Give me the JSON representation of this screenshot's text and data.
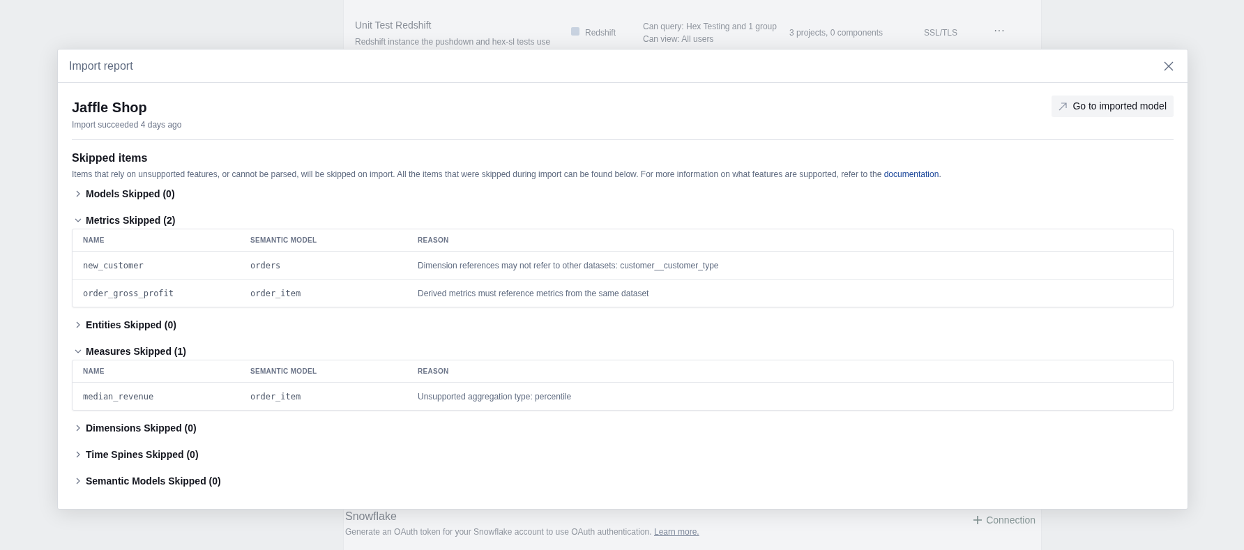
{
  "background": {
    "connection": {
      "name": "Unit Test Redshift",
      "description": "Redshift instance the pushdown and hex-sl tests use",
      "type_label": "Redshift",
      "permissions": [
        "Can query: Hex Testing and 1 group",
        "Can view: All users"
      ],
      "usage": "3 projects, 0 components",
      "security": "SSL/TLS",
      "more": "···"
    },
    "snowflake": {
      "title": "Snowflake",
      "description": "Generate an OAuth token for your Snowflake account to use OAuth authentication.",
      "link": "Learn more.",
      "button": "Connection"
    }
  },
  "modal": {
    "title": "Import report",
    "model": {
      "name": "Jaffle Shop",
      "status": "Import succeeded 4 days ago",
      "action_button": "Go to imported model"
    },
    "skipped": {
      "heading": "Skipped items",
      "description": "Items that rely on unsupported features, or cannot be parsed, will be skipped on import. All the items that were skipped during import can be found below. For more information on what features are supported, refer to the",
      "link": "documentation",
      "after_link": "."
    },
    "sections": [
      {
        "label": "Models Skipped (0)",
        "expanded": false
      },
      {
        "label": "Metrics Skipped (2)",
        "expanded": true,
        "table": {
          "columns": [
            "NAME",
            "SEMANTIC MODEL",
            "REASON"
          ],
          "rows": [
            [
              "new_customer",
              "orders",
              "Dimension references may not refer to other datasets: customer__customer_type"
            ],
            [
              "order_gross_profit",
              "order_item",
              "Derived metrics must reference metrics from the same dataset"
            ]
          ]
        }
      },
      {
        "label": "Entities Skipped (0)",
        "expanded": false
      },
      {
        "label": "Measures Skipped (1)",
        "expanded": true,
        "table": {
          "columns": [
            "NAME",
            "SEMANTIC MODEL",
            "REASON"
          ],
          "rows": [
            [
              "median_revenue",
              "order_item",
              "Unsupported aggregation type: percentile"
            ]
          ]
        }
      },
      {
        "label": "Dimensions Skipped (0)",
        "expanded": false
      },
      {
        "label": "Time Spines Skipped (0)",
        "expanded": false
      },
      {
        "label": "Semantic Models Skipped (0)",
        "expanded": false
      }
    ]
  }
}
